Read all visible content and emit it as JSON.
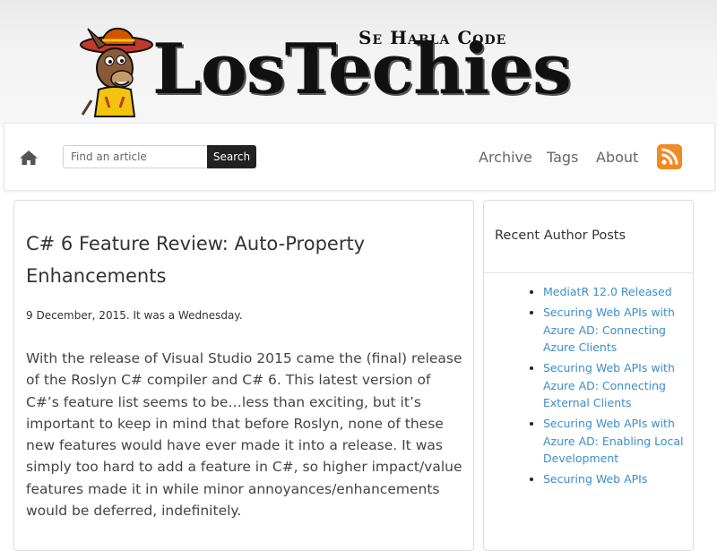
{
  "site": {
    "tagline": "Se Habla Code",
    "logo_text": "LosTechies"
  },
  "nav": {
    "search_placeholder": "Find an article",
    "search_button": "Search",
    "links": [
      "Archive",
      "Tags",
      "About"
    ]
  },
  "article": {
    "title": "C# 6 Feature Review: Auto-Property Enhancements",
    "date": "9 December, 2015. It was a Wednesday.",
    "body": "With the release of Visual Studio 2015 came the (final) release of the Roslyn C# compiler and C# 6. This latest version of C#’s feature list seems to be…less than exciting, but it’s important to keep in mind that before Roslyn, none of these new features would have ever made it into a release. It was simply too hard to add a feature in C#, so higher impact/value features made it in while minor annoyances/enhancements would be deferred, indefinitely."
  },
  "sidebar": {
    "title": "Recent Author Posts",
    "posts": [
      "MediatR 12.0 Released",
      "Securing Web APIs with Azure AD: Connecting Azure Clients",
      "Securing Web APIs with Azure AD: Connecting External Clients",
      "Securing Web APIs with Azure AD: Enabling Local Development",
      "Securing Web APIs"
    ]
  },
  "colors": {
    "link": "#3b8ec7",
    "rss": "#f08a24",
    "search_button": "#222222"
  }
}
